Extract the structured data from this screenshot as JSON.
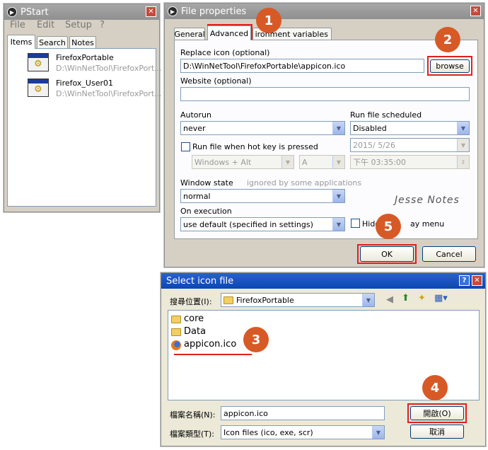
{
  "pstart": {
    "title": "PStart",
    "menu": [
      "File",
      "Edit",
      "Setup",
      "?"
    ],
    "tabs": [
      "Items",
      "Search",
      "Notes"
    ],
    "items": [
      {
        "name": "FirefoxPortable",
        "path": "D:\\WinNetTool\\FirefoxPort..."
      },
      {
        "name": "Firefox_User01",
        "path": "D:\\WinNetTool\\FirefoxPort..."
      }
    ]
  },
  "props": {
    "title": "File properties",
    "tabs": [
      "General",
      "Advanced",
      "Environment variables"
    ],
    "tab_env_visible": "ironment variables",
    "replace_icon_label": "Replace icon (optional)",
    "replace_icon_value": "D:\\WinNetTool\\FirefoxPortable\\appicon.ico",
    "browse": "browse",
    "website_label": "Website (optional)",
    "website_value": "",
    "autorun_label": "Autorun",
    "autorun_value": "never",
    "scheduled_label": "Run file scheduled",
    "scheduled_value": "Disabled",
    "hotkey_label": "Run file when hot key is pressed",
    "hotkey_mod": "Windows + Alt",
    "hotkey_key": "A",
    "date_value": "2015/  5/26",
    "time_value": "下午 03:35:00",
    "window_state_label": "Window state",
    "window_state_hint": "ignored by some applications",
    "window_state_value": "normal",
    "on_exec_label": "On execution",
    "on_exec_value": "use default (specified in settings)",
    "hide_tray_a": "Hide",
    "hide_tray_b": "ay menu",
    "watermark": "Jesse Notes",
    "ok": "OK",
    "cancel": "Cancel"
  },
  "select": {
    "title": "Select icon file",
    "look_in_label": "搜尋位置(I):",
    "look_in_value": "FirefoxPortable",
    "files": [
      "core",
      "Data",
      "appicon.ico"
    ],
    "filename_label": "檔案名稱(N):",
    "filename_value": "appicon.ico",
    "filetype_label": "檔案類型(T):",
    "filetype_value": "Icon files (ico, exe, scr)",
    "open": "開啟(O)",
    "cancel": "取消"
  },
  "badges": [
    "1",
    "2",
    "3",
    "4",
    "5"
  ],
  "colors": {
    "accent_red": "#e0201c",
    "badge_orange": "#d75a26",
    "titlebar_active": "#0b46b7",
    "titlebar_inactive": "#9a9a9a"
  }
}
